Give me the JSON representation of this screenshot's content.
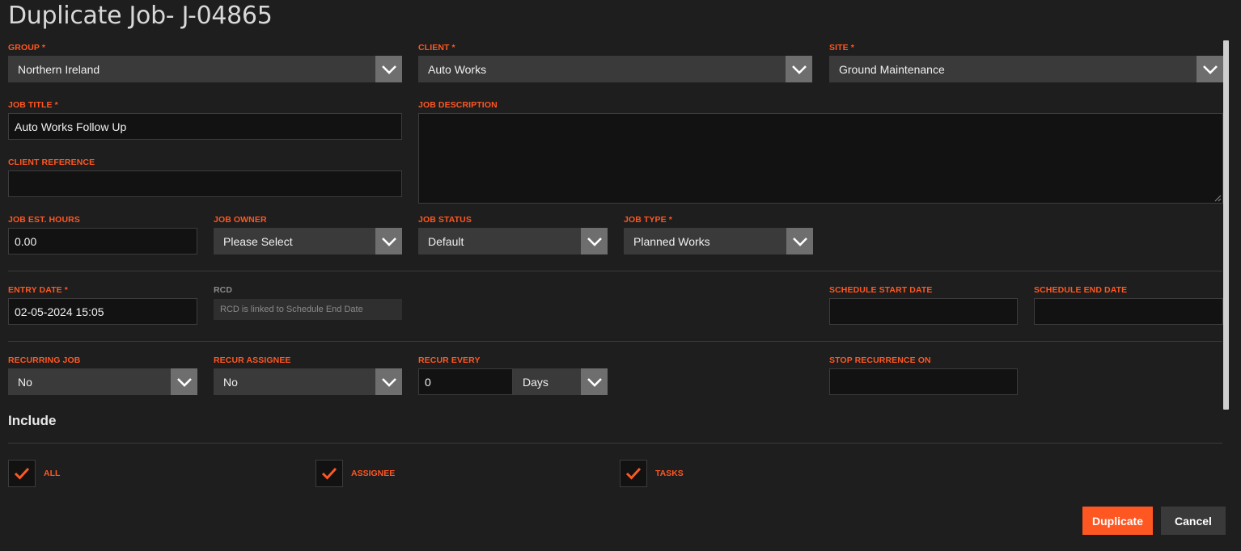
{
  "page": {
    "title": "Duplicate Job- J-04865"
  },
  "fields": {
    "group": {
      "label": "GROUP *",
      "value": "Northern Ireland"
    },
    "client": {
      "label": "CLIENT *",
      "value": "Auto Works"
    },
    "site": {
      "label": "SITE *",
      "value": "Ground Maintenance"
    },
    "job_title": {
      "label": "JOB TITLE *",
      "value": "Auto Works Follow Up"
    },
    "job_description": {
      "label": "JOB DESCRIPTION",
      "value": ""
    },
    "client_reference": {
      "label": "CLIENT REFERENCE",
      "value": ""
    },
    "job_est_hours": {
      "label": "JOB EST. HOURS",
      "value": "0.00"
    },
    "job_owner": {
      "label": "JOB OWNER",
      "value": "Please Select"
    },
    "job_status": {
      "label": "JOB STATUS",
      "value": "Default"
    },
    "job_type": {
      "label": "JOB TYPE *",
      "value": "Planned Works"
    },
    "entry_date": {
      "label": "ENTRY DATE *",
      "value": "02-05-2024 15:05"
    },
    "rcd": {
      "label": "RCD",
      "placeholder": "RCD is linked to Schedule End Date"
    },
    "schedule_start_date": {
      "label": "SCHEDULE START DATE",
      "value": ""
    },
    "schedule_end_date": {
      "label": "SCHEDULE END DATE",
      "value": ""
    },
    "recurring_job": {
      "label": "RECURRING JOB",
      "value": "No"
    },
    "recur_assignee": {
      "label": "RECUR ASSIGNEE",
      "value": "No"
    },
    "recur_every": {
      "label": "RECUR EVERY",
      "value": "0",
      "unit": "Days"
    },
    "stop_recurrence_on": {
      "label": "STOP RECURRENCE ON",
      "value": ""
    }
  },
  "include": {
    "title": "Include",
    "options": [
      {
        "label": "ALL",
        "checked": true
      },
      {
        "label": "ASSIGNEE",
        "checked": true
      },
      {
        "label": "TASKS",
        "checked": true
      }
    ]
  },
  "actions": {
    "duplicate": "Duplicate",
    "cancel": "Cancel"
  },
  "colors": {
    "accent": "#ff5722",
    "background": "#1e1e1e",
    "input_bg": "#121212",
    "select_bg": "#3a3a3a"
  }
}
